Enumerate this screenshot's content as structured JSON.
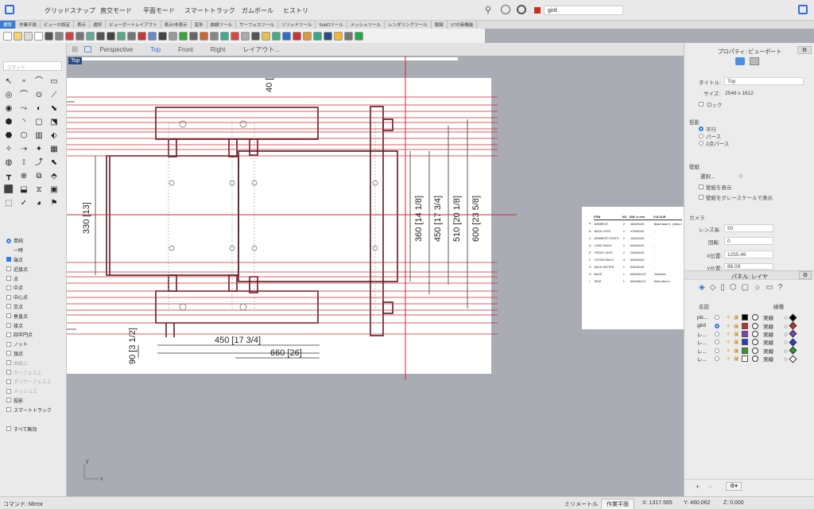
{
  "menu": {
    "items": [
      "グリッドスナップ",
      "直交モード",
      "平面モード",
      "スマートトラック",
      "ガムボール",
      "ヒストリ"
    ],
    "layer_name": "gird"
  },
  "tabs": [
    "標準",
    "作業平面",
    "ビューの設定",
    "表示",
    "選択",
    "ビューポートレイアウト",
    "表示/非表示",
    "変形",
    "曲線ツール",
    "サーフェスツール",
    "ソリッドツール",
    "SubDツール",
    "メッシュツール",
    "レンダリングツール",
    "製図",
    "V7の新機能"
  ],
  "left": {
    "command_placeholder": "コマンド",
    "osnap_mode_1": "単純",
    "osnap_mode_2": "一時",
    "snaps": [
      {
        "label": "端点",
        "checked": true,
        "enabled": true
      },
      {
        "label": "近接点",
        "checked": false,
        "enabled": true
      },
      {
        "label": "点",
        "checked": false,
        "enabled": true
      },
      {
        "label": "中点",
        "checked": false,
        "enabled": true
      },
      {
        "label": "中心点",
        "checked": false,
        "enabled": true
      },
      {
        "label": "交点",
        "checked": false,
        "enabled": true
      },
      {
        "label": "垂直点",
        "checked": false,
        "enabled": true
      },
      {
        "label": "接点",
        "checked": false,
        "enabled": true
      },
      {
        "label": "四半円点",
        "checked": false,
        "enabled": true
      },
      {
        "label": "ノット",
        "checked": false,
        "enabled": true
      },
      {
        "label": "頂点",
        "checked": false,
        "enabled": true
      },
      {
        "label": "曲線上",
        "checked": false,
        "enabled": false
      },
      {
        "label": "サーフェス上",
        "checked": false,
        "enabled": false
      },
      {
        "label": "ポリサーフェス上",
        "checked": false,
        "enabled": false
      },
      {
        "label": "メッシュ上",
        "checked": false,
        "enabled": false
      },
      {
        "label": "投影",
        "checked": false,
        "enabled": true
      },
      {
        "label": "スマートトラック",
        "checked": false,
        "enabled": true
      }
    ],
    "disable_all": "すべて無効"
  },
  "viewtabs": [
    "Perspective",
    "Top",
    "Front",
    "Right",
    "レイアウト..."
  ],
  "viewport": {
    "label": "Top",
    "dims": {
      "d40": "40 [1",
      "d330": "330 [13]",
      "d90": "90 [3 1/2]",
      "d450": "450 [17 3/4]",
      "d660": "660 [26]",
      "d360": "360 [14 1/8]",
      "d450v": "450 [17 3/4]",
      "d510": "510 [20 1/8]",
      "d600": "600 [23 5/8]"
    },
    "axis_x": "x",
    "axis_y": "y",
    "parts_table": {
      "headers": [
        "ITEM",
        "NO.",
        "DIM. in mm",
        "COLOUR"
      ],
      "rows": [
        [
          "A",
          "ARMREST",
          "2",
          "450x90x30",
          "Black stain fi.. yellow lemon"
        ],
        [
          "B",
          "BACK LEGS",
          "2",
          "475x30x30",
          "-"
        ],
        [
          "C",
          "ARMREST POSTS",
          "2",
          "430x30x30",
          "-"
        ],
        [
          "D",
          "LONG RAILS",
          "2",
          "640x30x30",
          "-"
        ],
        [
          "E",
          "FRONT LEGS",
          "2",
          "230x30x30",
          "-"
        ],
        [
          "F",
          "CROSS RAILS",
          "4",
          "600x30x30",
          "-"
        ],
        [
          "G",
          "BACK BATTEN",
          "1",
          "640x30x30",
          "-"
        ],
        [
          "H",
          "BACK",
          "1",
          "640x330x12",
          "Vermilion"
        ],
        [
          "I",
          "SEAT",
          "1",
          "640x360x12",
          "Dark ultra m..."
        ]
      ]
    }
  },
  "props": {
    "title": "プロパティ: ビューポート",
    "title_label": "タイトル:",
    "title_value": "Top",
    "size_label": "サイズ:",
    "size_value": "2546 x 1812",
    "lock_label": "ロック",
    "projection_header": "投影",
    "proj_parallel": "平行",
    "proj_perspective": "パース",
    "proj_two_point": "2点パース",
    "wallpaper_header": "壁紙",
    "wallpaper_select": "選択...",
    "wallpaper_show": "壁紙を表示",
    "wallpaper_gray": "壁紙をグレースケールで表示",
    "camera_header": "カメラ",
    "lens_label": "レンズ長:",
    "lens_value": "50",
    "rotation_label": "回転:",
    "rotation_value": "0",
    "xpos_label": "X位置:",
    "xpos_value": "1255.46",
    "ypos_label": "Y位置:",
    "ypos_value": "86.09"
  },
  "layers": {
    "title": "パネル: レイヤ",
    "col_name": "名前",
    "col_linetype": "線種",
    "rows": [
      {
        "name": "pic...",
        "current": false,
        "color": "#000000",
        "linetype": "実線",
        "print": "#000000"
      },
      {
        "name": "gird",
        "current": true,
        "color": "#c0322a",
        "linetype": "実線",
        "print": "#c0322a"
      },
      {
        "name": "レ...",
        "current": false,
        "color": "#7f3fbf",
        "linetype": "実線",
        "print": "#7f3fbf"
      },
      {
        "name": "レ...",
        "current": false,
        "color": "#1f3fd0",
        "linetype": "実線",
        "print": "#1f3fd0"
      },
      {
        "name": "レ...",
        "current": false,
        "color": "#2e9a2e",
        "linetype": "実線",
        "print": "#2e9a2e"
      },
      {
        "name": "レ...",
        "current": false,
        "color": "#ffffff",
        "linetype": "実線",
        "print": "#ffffff"
      }
    ]
  },
  "status": {
    "command": "コマンド: Mirror",
    "units": "ミリメートル",
    "cplane": "作業平面",
    "x": "X: 1317.565",
    "y": "Y: 460.062",
    "z": "Z: 0.000"
  },
  "colors": {
    "accent": "#2f7ae5",
    "grid_line": "#d8242a",
    "drawing_line": "#5a1a22"
  }
}
